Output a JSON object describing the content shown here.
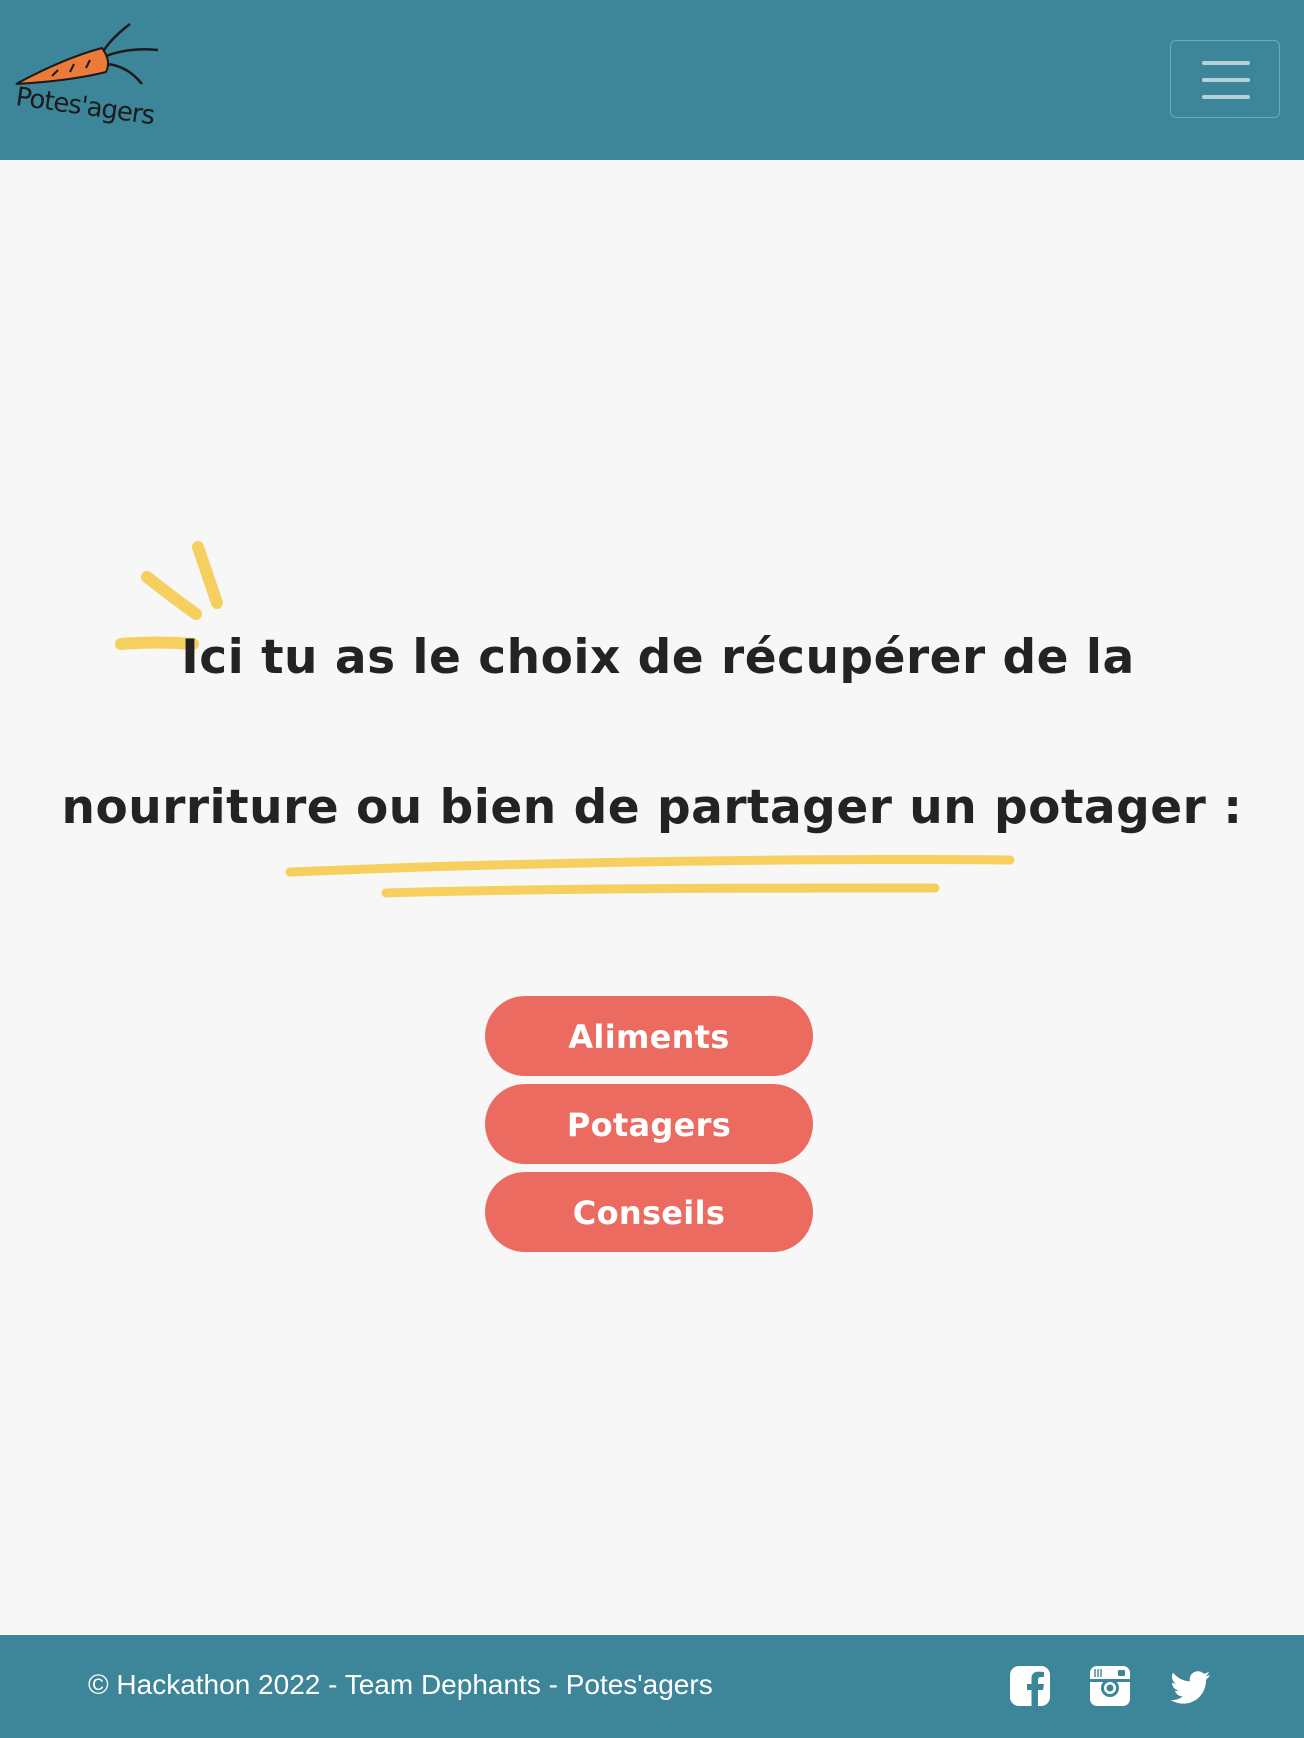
{
  "header": {
    "logo_text": "Potes'agers",
    "menu_button_label": "Toggle navigation"
  },
  "main": {
    "headline_line1": "Ici tu as le choix de récupérer de la",
    "headline_line2": "nourriture ou bien de partager un potager :",
    "buttons": [
      {
        "label": "Aliments"
      },
      {
        "label": "Potagers"
      },
      {
        "label": "Conseils"
      }
    ]
  },
  "footer": {
    "copyright": "© Hackathon 2022 - Team Dephants - Potes'agers",
    "social": [
      {
        "icon": "facebook-icon"
      },
      {
        "icon": "instagram-icon"
      },
      {
        "icon": "twitter-icon"
      }
    ]
  },
  "colors": {
    "header_bg": "#3d8599",
    "page_bg": "#f7f7f7",
    "button_bg": "#ec6b61",
    "accent_yellow": "#f5d05e",
    "carrot_orange": "#ec7a3a",
    "text_dark": "#232323"
  }
}
